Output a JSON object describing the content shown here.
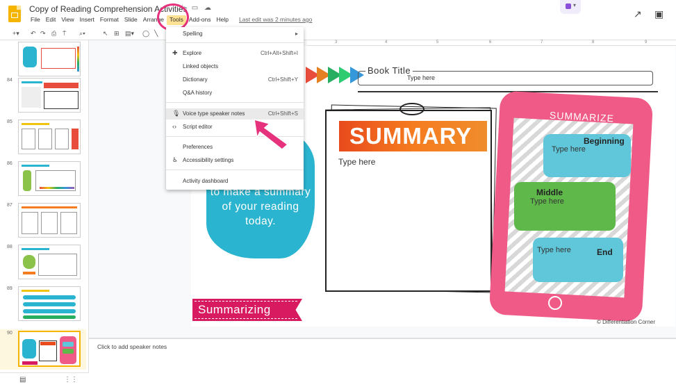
{
  "header": {
    "doc_title": "Copy of Reading Comprehension Activities",
    "title_icons": [
      "star-icon",
      "folder-icon",
      "cloud-icon"
    ],
    "last_edit": "Last edit was 2 minutes ago",
    "menu": [
      "File",
      "Edit",
      "View",
      "Insert",
      "Format",
      "Slide",
      "Arrange",
      "Tools",
      "Add-ons",
      "Help"
    ],
    "active_menu": "Tools"
  },
  "tools_menu": {
    "items": [
      {
        "label": "Spelling",
        "shortcut": "▸",
        "icon": ""
      },
      {
        "label": "Explore",
        "shortcut": "Ctrl+Alt+Shift+I",
        "icon": "explore-icon"
      },
      {
        "label": "Linked objects",
        "shortcut": "",
        "icon": ""
      },
      {
        "label": "Dictionary",
        "shortcut": "Ctrl+Shift+Y",
        "icon": ""
      },
      {
        "label": "Q&A history",
        "shortcut": "",
        "icon": ""
      },
      {
        "label": "Voice type speaker notes",
        "shortcut": "Ctrl+Shift+S",
        "icon": "microphone-icon"
      },
      {
        "label": "Script editor",
        "shortcut": "",
        "icon": "code-icon"
      },
      {
        "label": "Preferences",
        "shortcut": "",
        "icon": ""
      },
      {
        "label": "Accessibility settings",
        "shortcut": "",
        "icon": "accessibility-icon"
      },
      {
        "label": "Activity dashboard",
        "shortcut": "",
        "icon": ""
      }
    ],
    "highlighted": "Voice type speaker notes"
  },
  "filmstrip": {
    "slide_numbers": [
      "84",
      "85",
      "86",
      "87",
      "88",
      "89",
      "90"
    ],
    "selected": "90"
  },
  "ruler": {
    "numbers": [
      "3",
      "4",
      "5",
      "6",
      "7",
      "8",
      "9"
    ]
  },
  "slide": {
    "book_title_label": "Book Title",
    "book_title_placeholder": "Type here",
    "blob_text": "to make a summary of your reading today.",
    "summary_title": "SUMMARY",
    "summary_placeholder": "Type here",
    "phone_title": "SUMMARIZE",
    "bubble_beginning_label": "Beginning",
    "bubble_beginning_placeholder": "Type here",
    "bubble_middle_label": "Middle",
    "bubble_middle_placeholder": "Type here",
    "bubble_end_label": "End",
    "bubble_end_placeholder": "Type here",
    "banner_text": "Summarizing",
    "copyright": "© Differentiation Corner",
    "arrow_colors": [
      "#e74c3c",
      "#e67e22",
      "#27ae60",
      "#2ecc71",
      "#3498db"
    ]
  },
  "notes": {
    "placeholder": "Click to add speaker notes"
  },
  "colors": {
    "accent": "#e6317d",
    "menu_highlight": "#fde293",
    "phone": "#ef5a86",
    "blob": "#2bb4cf"
  }
}
